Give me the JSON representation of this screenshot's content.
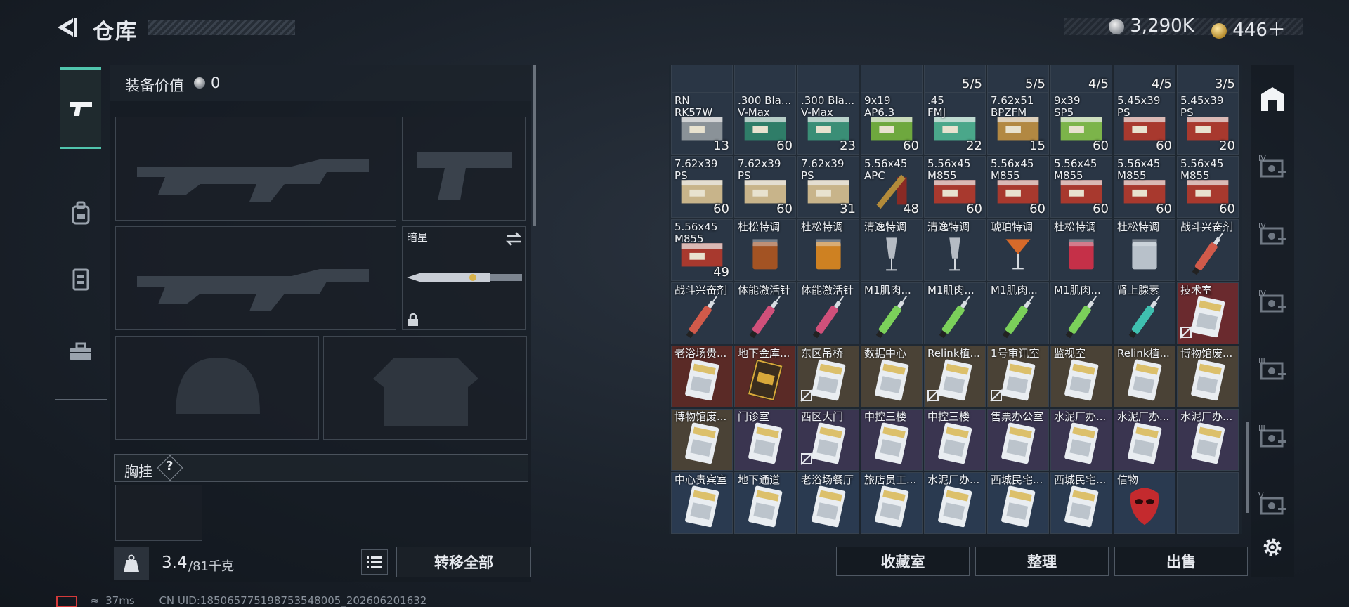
{
  "header": {
    "title": "仓库",
    "currency1": "3,290K",
    "currency2": "446＋"
  },
  "equipment": {
    "label": "装备价值",
    "value": "0",
    "knife_name": "暗星",
    "chest_label": "胸挂",
    "chest_help": "?"
  },
  "weight": {
    "current": "3.4",
    "max": "/81千克"
  },
  "buttons": {
    "transfer_all": "转移全部",
    "collection": "收藏室",
    "organize": "整理",
    "sell": "出售"
  },
  "inventory": {
    "top_partial": [
      "",
      "",
      "",
      "",
      "5/5",
      "5/5",
      "4/5",
      "4/5",
      "3/5"
    ],
    "rows": [
      [
        {
          "name": "RN\nRK57W",
          "qty": "13",
          "type": "ammo",
          "color": "#8a9298"
        },
        {
          "name": ".300 Bla...\nV-Max",
          "qty": "60",
          "type": "ammo",
          "color": "#2f7d68"
        },
        {
          "name": ".300 Bla...\nV-Max",
          "qty": "23",
          "type": "ammo",
          "color": "#3a8e76"
        },
        {
          "name": "9x19\nAP6.3",
          "qty": "60",
          "type": "ammo",
          "color": "#6ea83e"
        },
        {
          "name": ".45\nFMJ",
          "qty": "22",
          "type": "ammo",
          "color": "#4aa78a"
        },
        {
          "name": "7.62x51\nBPZFM",
          "qty": "15",
          "type": "ammo",
          "color": "#b28842"
        },
        {
          "name": "9x39\nSP5",
          "qty": "60",
          "type": "ammo",
          "color": "#7cb44a"
        },
        {
          "name": "5.45x39\nPS",
          "qty": "60",
          "type": "ammo",
          "color": "#a8392e"
        },
        {
          "name": "5.45x39\nPS",
          "qty": "20",
          "type": "ammo",
          "color": "#a8392e"
        }
      ],
      [
        {
          "name": "7.62x39\nPS",
          "qty": "60",
          "type": "ammo",
          "color": "#c8b48a"
        },
        {
          "name": "7.62x39\nPS",
          "qty": "60",
          "type": "ammo",
          "color": "#c8b48a"
        },
        {
          "name": "7.62x39\nPS",
          "qty": "31",
          "type": "ammo",
          "color": "#c8b48a"
        },
        {
          "name": "5.56x45\nAPC",
          "qty": "48",
          "type": "bullet",
          "color": "#b38b3a"
        },
        {
          "name": "5.56x45\nM855",
          "qty": "60",
          "type": "ammo",
          "color": "#a8392e"
        },
        {
          "name": "5.56x45\nM855",
          "qty": "60",
          "type": "ammo",
          "color": "#a8392e"
        },
        {
          "name": "5.56x45\nM855",
          "qty": "60",
          "type": "ammo",
          "color": "#a8392e"
        },
        {
          "name": "5.56x45\nM855",
          "qty": "60",
          "type": "ammo",
          "color": "#a8392e"
        },
        {
          "name": "5.56x45\nM855",
          "qty": "60",
          "type": "ammo",
          "color": "#a8392e"
        }
      ],
      [
        {
          "name": "5.56x45\nM855",
          "qty": "49",
          "type": "ammo",
          "color": "#a8392e"
        },
        {
          "name": "杜松特调",
          "qty": "",
          "type": "glass",
          "color": "#b0561f"
        },
        {
          "name": "杜松特调",
          "qty": "",
          "type": "glass",
          "color": "#e08a1e"
        },
        {
          "name": "清逸特调",
          "qty": "",
          "type": "flute",
          "color": "#d8dde2"
        },
        {
          "name": "清逸特调",
          "qty": "",
          "type": "flute",
          "color": "#d8dde2"
        },
        {
          "name": "琥珀特调",
          "qty": "",
          "type": "martini",
          "color": "#d66a2a"
        },
        {
          "name": "杜松特调",
          "qty": "",
          "type": "glass",
          "color": "#d63048"
        },
        {
          "name": "杜松特调",
          "qty": "",
          "type": "glass",
          "color": "#c8d0d8"
        },
        {
          "name": "战斗兴奋剂",
          "qty": "",
          "type": "syringe",
          "color": "#d05a4a"
        }
      ],
      [
        {
          "name": "战斗兴奋剂",
          "qty": "",
          "type": "syringe",
          "color": "#d05a4a"
        },
        {
          "name": "体能激活针",
          "qty": "",
          "type": "syringe",
          "color": "#d0507a"
        },
        {
          "name": "体能激活针",
          "qty": "",
          "type": "syringe",
          "color": "#d0507a"
        },
        {
          "name": "M1肌肉...",
          "qty": "",
          "type": "syringe",
          "color": "#7bd05a"
        },
        {
          "name": "M1肌肉...",
          "qty": "",
          "type": "syringe",
          "color": "#7bd05a"
        },
        {
          "name": "M1肌肉...",
          "qty": "",
          "type": "syringe",
          "color": "#7bd05a"
        },
        {
          "name": "M1肌肉...",
          "qty": "",
          "type": "syringe",
          "color": "#7bd05a"
        },
        {
          "name": "肾上腺素",
          "qty": "",
          "type": "syringe",
          "color": "#3fc0b0"
        },
        {
          "name": "技术室",
          "qty": "",
          "type": "card",
          "color": "#6a2a2e",
          "nolink": true
        }
      ],
      [
        {
          "name": "老浴场贵...",
          "qty": "",
          "type": "card",
          "color": "#5a2a26"
        },
        {
          "name": "地下金库...",
          "qty": "",
          "type": "goldcard",
          "color": "#5a2a26"
        },
        {
          "name": "东区吊桥",
          "qty": "",
          "type": "card",
          "color": "#4a4236",
          "nolink": true
        },
        {
          "name": "数据中心",
          "qty": "",
          "type": "card",
          "color": "#4a4236"
        },
        {
          "name": "Relink植...",
          "qty": "",
          "type": "card",
          "color": "#4a4236",
          "nolink": true
        },
        {
          "name": "1号审讯室",
          "qty": "",
          "type": "card",
          "color": "#4a4236",
          "nolink": true
        },
        {
          "name": "监视室",
          "qty": "",
          "type": "card",
          "color": "#4a4236"
        },
        {
          "name": "Relink植...",
          "qty": "",
          "type": "card",
          "color": "#4a4236"
        },
        {
          "name": "博物馆废...",
          "qty": "",
          "type": "card",
          "color": "#4a4236"
        }
      ],
      [
        {
          "name": "博物馆废...",
          "qty": "",
          "type": "card",
          "color": "#4a4236"
        },
        {
          "name": "门诊室",
          "qty": "",
          "type": "card",
          "color": "#3a3550"
        },
        {
          "name": "西区大门",
          "qty": "",
          "type": "card",
          "color": "#3a3550",
          "nolink": true
        },
        {
          "name": "中控三楼",
          "qty": "",
          "type": "card",
          "color": "#3a3550"
        },
        {
          "name": "中控三楼",
          "qty": "",
          "type": "card",
          "color": "#3a3550"
        },
        {
          "name": "售票办公室",
          "qty": "",
          "type": "card",
          "color": "#3a3550"
        },
        {
          "name": "水泥厂办...",
          "qty": "",
          "type": "card",
          "color": "#3a3550"
        },
        {
          "name": "水泥厂办...",
          "qty": "",
          "type": "card",
          "color": "#3a3550"
        },
        {
          "name": "水泥厂办...",
          "qty": "",
          "type": "card",
          "color": "#3a3550"
        }
      ],
      [
        {
          "name": "中心贵宾室",
          "qty": "",
          "type": "card",
          "color": "#2a3a50"
        },
        {
          "name": "地下通道",
          "qty": "",
          "type": "card",
          "color": "#2a3a50"
        },
        {
          "name": "老浴场餐厅",
          "qty": "",
          "type": "card",
          "color": "#2a3a50"
        },
        {
          "name": "旅店员工...",
          "qty": "",
          "type": "card",
          "color": "#2a3a50"
        },
        {
          "name": "水泥厂办...",
          "qty": "",
          "type": "card",
          "color": "#2a3a50"
        },
        {
          "name": "西城民宅...",
          "qty": "",
          "type": "card",
          "color": "#2a3a50"
        },
        {
          "name": "西城民宅...",
          "qty": "",
          "type": "card",
          "color": "#2a3a50"
        },
        {
          "name": "信物",
          "qty": "",
          "type": "mask",
          "color": "#2a3a50"
        },
        {
          "name": "",
          "qty": "",
          "type": "empty",
          "color": "#2a3645"
        }
      ]
    ]
  },
  "footer": {
    "ping": "37ms",
    "uid": "CN UID:1850657751987535480​05_202606201632"
  },
  "icons": [
    "back-arrow-icon",
    "silver-coin-icon",
    "gold-coin-icon",
    "pistol-icon",
    "backpack-icon",
    "vest-icon",
    "toolbox-icon",
    "swap-icon",
    "lock-icon",
    "weight-icon",
    "list-icon",
    "home-icon",
    "key-room-icon",
    "settings-icon",
    "battery-icon",
    "wifi-icon"
  ]
}
